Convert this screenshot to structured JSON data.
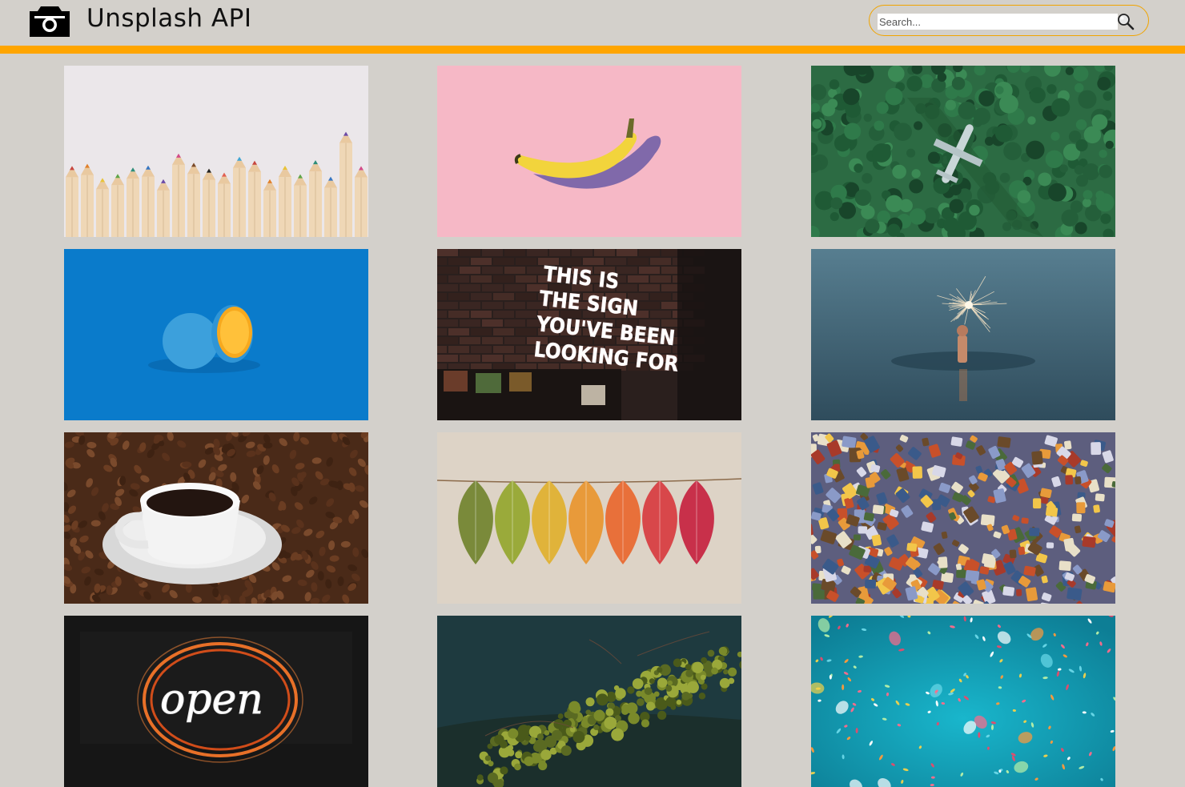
{
  "header": {
    "title": "Unsplash API",
    "logo_icon": "camera-icon"
  },
  "search": {
    "placeholder": "Search...",
    "value": "",
    "button_icon": "magnifier-icon"
  },
  "colors": {
    "background": "#d3d0cb",
    "accent": "#ffa500"
  },
  "photos": [
    {
      "subject": "colored-pencils"
    },
    {
      "subject": "banana-on-pink"
    },
    {
      "subject": "plane-in-forest"
    },
    {
      "subject": "blue-painted-orange"
    },
    {
      "subject": "neon-sign-brick-wall",
      "text": "THIS IS THE SIGN YOU'VE BEEN LOOKING FOR"
    },
    {
      "subject": "sparkler-in-sea"
    },
    {
      "subject": "coffee-cup-on-beans"
    },
    {
      "subject": "autumn-leaves-on-string"
    },
    {
      "subject": "jigsaw-puzzle-pieces"
    },
    {
      "subject": "open-neon-sign",
      "text": "open"
    },
    {
      "subject": "moss-over-water"
    },
    {
      "subject": "confetti-on-teal"
    }
  ]
}
